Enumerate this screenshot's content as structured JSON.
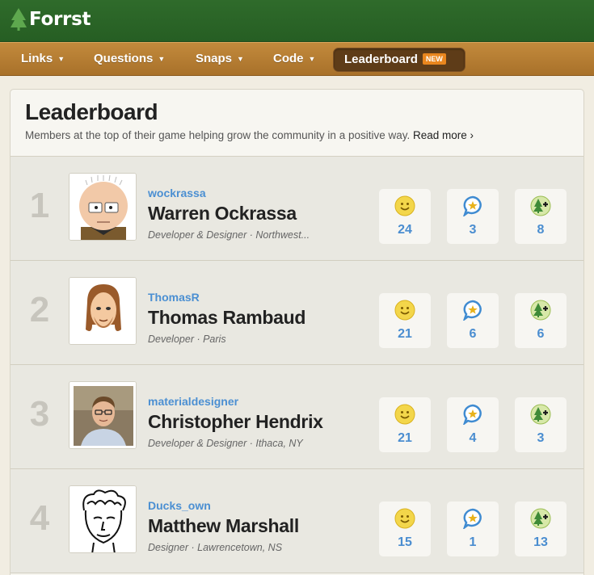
{
  "app": {
    "name": "Forrst"
  },
  "nav": {
    "items": [
      {
        "label": "Links"
      },
      {
        "label": "Questions"
      },
      {
        "label": "Snaps"
      },
      {
        "label": "Code"
      }
    ],
    "active": {
      "label": "Leaderboard",
      "badge": "NEW"
    },
    "caret": "▼"
  },
  "page": {
    "title": "Leaderboard",
    "description": "Members at the top of their game helping grow the community in a positive way.",
    "read_more": "Read more ›"
  },
  "stat_icons": [
    "smiley-icon",
    "star-bubble-icon",
    "tree-plus-icon"
  ],
  "leaders": [
    {
      "rank": "1",
      "username": "wockrassa",
      "name": "Warren Ockrassa",
      "meta": "Developer & Designer · Northwest...",
      "stats": [
        "24",
        "3",
        "8"
      ]
    },
    {
      "rank": "2",
      "username": "ThomasR",
      "name": "Thomas Rambaud",
      "meta": "Developer · Paris",
      "stats": [
        "21",
        "6",
        "6"
      ]
    },
    {
      "rank": "3",
      "username": "materialdesigner",
      "name": "Christopher Hendrix",
      "meta": "Developer & Designer · Ithaca, NY",
      "stats": [
        "21",
        "4",
        "3"
      ]
    },
    {
      "rank": "4",
      "username": "Ducks_own",
      "name": "Matthew Marshall",
      "meta": "Designer · Lawrencetown, NS",
      "stats": [
        "15",
        "1",
        "13"
      ]
    }
  ],
  "colors": {
    "header_green": "#2f6b2b",
    "nav_brown": "#b47b32",
    "active_tab": "#5e3c18",
    "badge_orange": "#e9861e",
    "link_blue": "#4b8fd2",
    "stat_blue": "#4a8dd0"
  }
}
